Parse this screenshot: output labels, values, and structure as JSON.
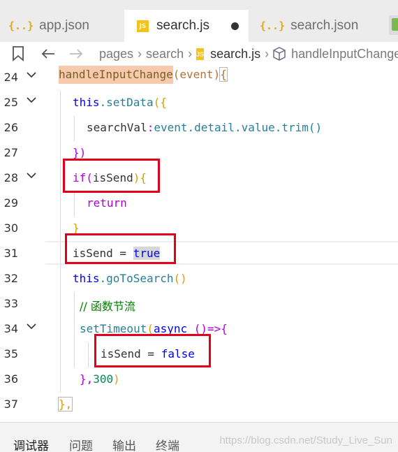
{
  "top_strip_text": "",
  "tabs": [
    {
      "label": "app.json",
      "icon": "{..}"
    },
    {
      "label": "search.js",
      "icon": "JS"
    },
    {
      "label": "search.json",
      "icon": "{..}"
    }
  ],
  "breadcrumb": {
    "segments": [
      "pages",
      "search",
      "search.js",
      "handleInputChange"
    ],
    "file_icon": "JS"
  },
  "editor": {
    "line_numbers": [
      "24",
      "25",
      "26",
      "27",
      "28",
      "29",
      "30",
      "31",
      "32",
      "33",
      "34",
      "35",
      "36",
      "37"
    ],
    "code": {
      "l24_name": "handleInputChange",
      "l24_params": "(event)",
      "l24_brace": "{",
      "l25_this": "this",
      "l25_method": ".setData",
      "l25_open": "({",
      "l26_key": "searchVal",
      "l26_colon": ":",
      "l26_value": "event.detail.value.trim",
      "l26_parens": "()",
      "l27_close": "})",
      "l28_if": "if",
      "l28_open": "(",
      "l28_cond": "isSend",
      "l28_close": "){",
      "l29_return": "return",
      "l30_close": "}",
      "l31_var": "isSend",
      "l31_eq": " = ",
      "l31_val": "true",
      "l32_this": "this",
      "l32_method": ".goToSearch",
      "l32_parens": "()",
      "l33_comment": "// 函数节流",
      "l34_fn": "setTimeout",
      "l34_open": "(",
      "l34_async": "async",
      "l34_arrow": " ()=>{",
      "l35_var": "isSend",
      "l35_eq": " = ",
      "l35_val": "false",
      "l36_close": "},",
      "l36_num": "300",
      "l36_paren": ")",
      "l37_close": "},"
    }
  },
  "panel": {
    "tabs": [
      "调试器",
      "问题",
      "输出",
      "终端"
    ],
    "watermark": "https://blog.csdn.net/Study_Live_Sun"
  },
  "colors": {
    "highlight_box": "#e3001b",
    "tab_bar_bg": "#ececec",
    "selection_bg": "#f7c9ad"
  }
}
